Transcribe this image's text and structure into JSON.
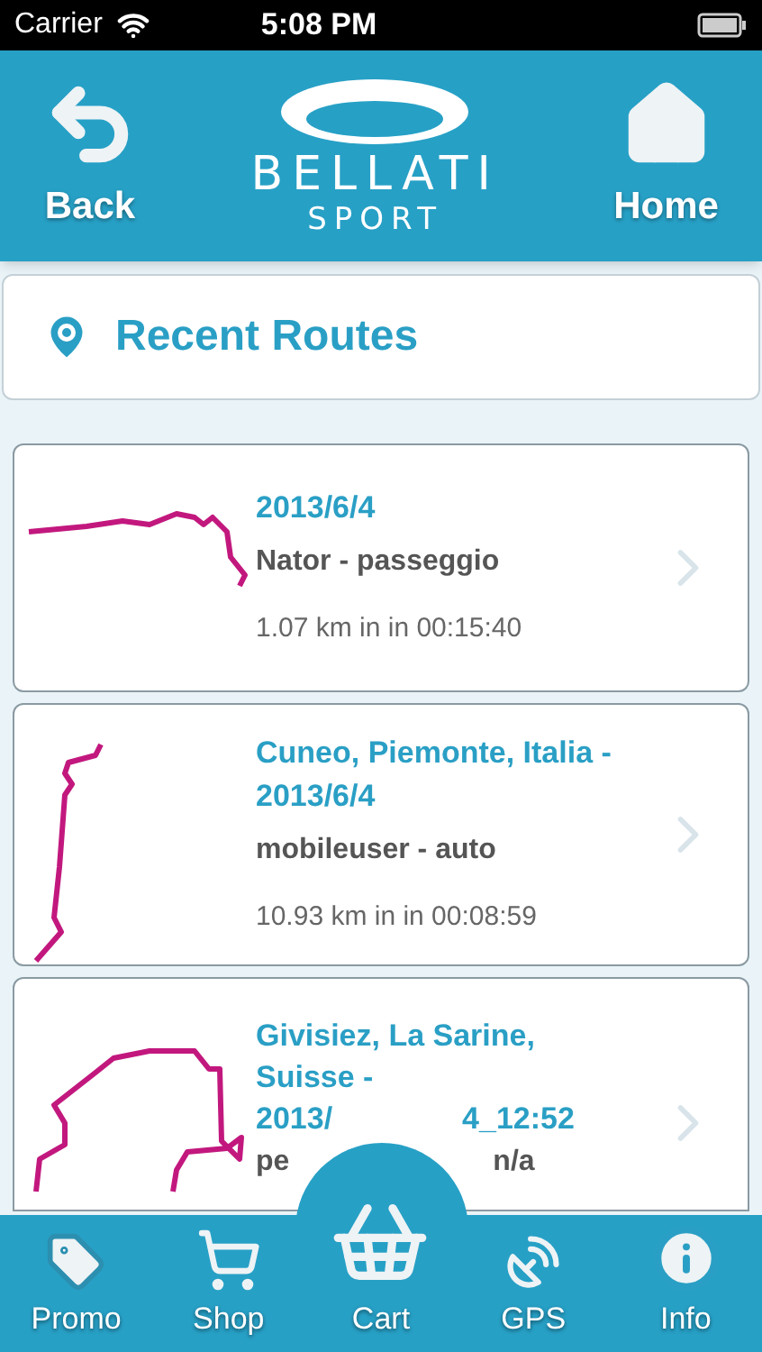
{
  "status_bar": {
    "carrier": "Carrier",
    "time": "5:08 PM"
  },
  "header": {
    "back": "Back",
    "logo_top": "BELLATI",
    "logo_bottom": "SPORT",
    "home": "Home"
  },
  "section": {
    "title": "Recent Routes"
  },
  "routes": [
    {
      "kind": "full",
      "title": [
        "2013/6/4"
      ],
      "subtitle": "Nator - passeggio",
      "stats": "1.07 km in in 00:15:40"
    },
    {
      "kind": "full",
      "title": [
        "Cuneo, Piemonte, Italia -",
        "2013/6/4"
      ],
      "subtitle": "mobileuser - auto",
      "stats": "10.93 km in in 00:08:59"
    },
    {
      "kind": "covered",
      "title": [
        "Givisiez, La Sarine,",
        "Suisse -"
      ],
      "title_left": "2013/",
      "title_right": "4_12:52",
      "subtitle_left": "pe",
      "subtitle_right": "n/a"
    }
  ],
  "tabs": [
    {
      "kind": "promo",
      "label": "Promo"
    },
    {
      "kind": "shop",
      "label": "Shop"
    },
    {
      "kind": "cart",
      "label": "Cart"
    },
    {
      "kind": "gps",
      "label": "GPS"
    },
    {
      "kind": "info",
      "label": "Info"
    }
  ]
}
